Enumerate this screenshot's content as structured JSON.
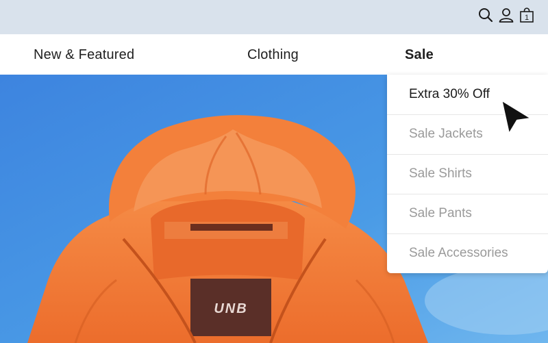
{
  "topbar": {
    "icons": [
      "search-icon",
      "account-icon",
      "cart-icon"
    ],
    "cart_count": "1",
    "background": "#d9e2ec"
  },
  "nav": {
    "items": [
      {
        "label": "New & Featured"
      },
      {
        "label": "Clothing"
      },
      {
        "label": "Sale",
        "active": true
      }
    ]
  },
  "dropdown": {
    "items": [
      {
        "label": "Extra 30% Off",
        "active": true
      },
      {
        "label": "Sale Jackets"
      },
      {
        "label": "Sale Shirts"
      },
      {
        "label": "Sale Pants"
      },
      {
        "label": "Sale Accessories"
      }
    ]
  },
  "hero": {
    "product_label": "UNB",
    "jacket_color": "#f17a3a",
    "sky_color": "#3f8fe0"
  },
  "cursor": {
    "icon": "arrow-cursor-icon"
  }
}
